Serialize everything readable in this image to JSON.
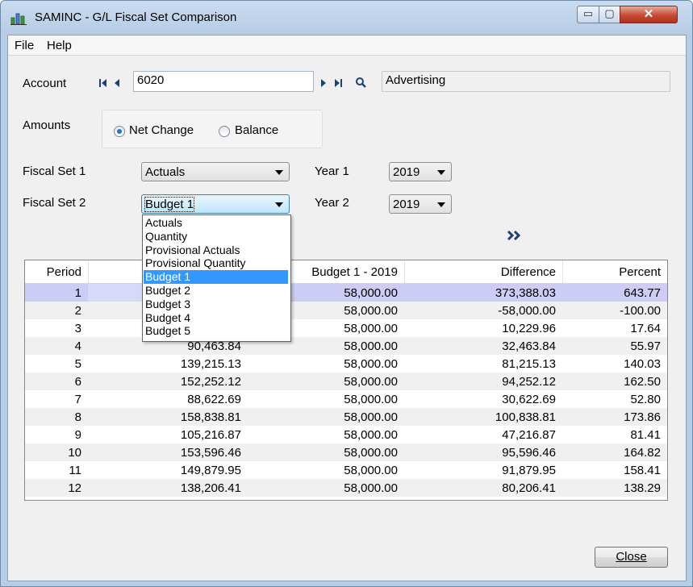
{
  "window": {
    "title": "SAMINC - G/L Fiscal Set Comparison",
    "minimize_glyph": "▭",
    "maximize_glyph": "▢",
    "close_glyph": "✕"
  },
  "menu": [
    "File",
    "Help"
  ],
  "account": {
    "label": "Account",
    "value": "6020",
    "description": "Advertising"
  },
  "amounts": {
    "label": "Amounts",
    "options": [
      "Net Change",
      "Balance"
    ],
    "selected": "Net Change"
  },
  "fiscal_set_1": {
    "label": "Fiscal Set 1",
    "value": "Actuals"
  },
  "fiscal_set_2": {
    "label": "Fiscal Set 2",
    "value": "Budget 1"
  },
  "year_1": {
    "label": "Year 1",
    "value": "2019"
  },
  "year_2": {
    "label": "Year 2",
    "value": "2019"
  },
  "dropdown": {
    "options": [
      "Actuals",
      "Quantity",
      "Provisional Actuals",
      "Provisional Quantity",
      "Budget 1",
      "Budget 2",
      "Budget 3",
      "Budget 4",
      "Budget 5"
    ],
    "selected_index": 4
  },
  "grid": {
    "columns": [
      "Period",
      "",
      "Budget 1 - 2019",
      "Difference",
      "Percent"
    ],
    "rows": [
      [
        "1",
        "",
        "58,000.00",
        "373,388.03",
        "643.77"
      ],
      [
        "2",
        "",
        "58,000.00",
        "-58,000.00",
        "-100.00"
      ],
      [
        "3",
        "",
        "58,000.00",
        "10,229.96",
        "17.64"
      ],
      [
        "4",
        "90,463.84",
        "58,000.00",
        "32,463.84",
        "55.97"
      ],
      [
        "5",
        "139,215.13",
        "58,000.00",
        "81,215.13",
        "140.03"
      ],
      [
        "6",
        "152,252.12",
        "58,000.00",
        "94,252.12",
        "162.50"
      ],
      [
        "7",
        "88,622.69",
        "58,000.00",
        "30,622.69",
        "52.80"
      ],
      [
        "8",
        "158,838.81",
        "58,000.00",
        "100,838.81",
        "173.86"
      ],
      [
        "9",
        "105,216.87",
        "58,000.00",
        "47,216.87",
        "81.41"
      ],
      [
        "10",
        "153,596.46",
        "58,000.00",
        "95,596.46",
        "164.82"
      ],
      [
        "11",
        "149,879.95",
        "58,000.00",
        "91,879.95",
        "158.41"
      ],
      [
        "12",
        "138,206.41",
        "58,000.00",
        "80,206.41",
        "138.29"
      ]
    ],
    "selected_row": 0
  },
  "buttons": {
    "close": "Close"
  },
  "icons": {
    "app": "chart-app-icon",
    "first": "first-record-icon",
    "prev": "previous-record-icon",
    "next": "next-record-icon",
    "last": "last-record-icon",
    "finder": "magnifier-icon",
    "expand": "double-chevron-right-icon"
  },
  "colors": {
    "selection_row": "#ccccf5",
    "dropdown_highlight": "#3399ff",
    "close_button_red": "#c74b34",
    "nav_arrow": "#1f3f78"
  }
}
